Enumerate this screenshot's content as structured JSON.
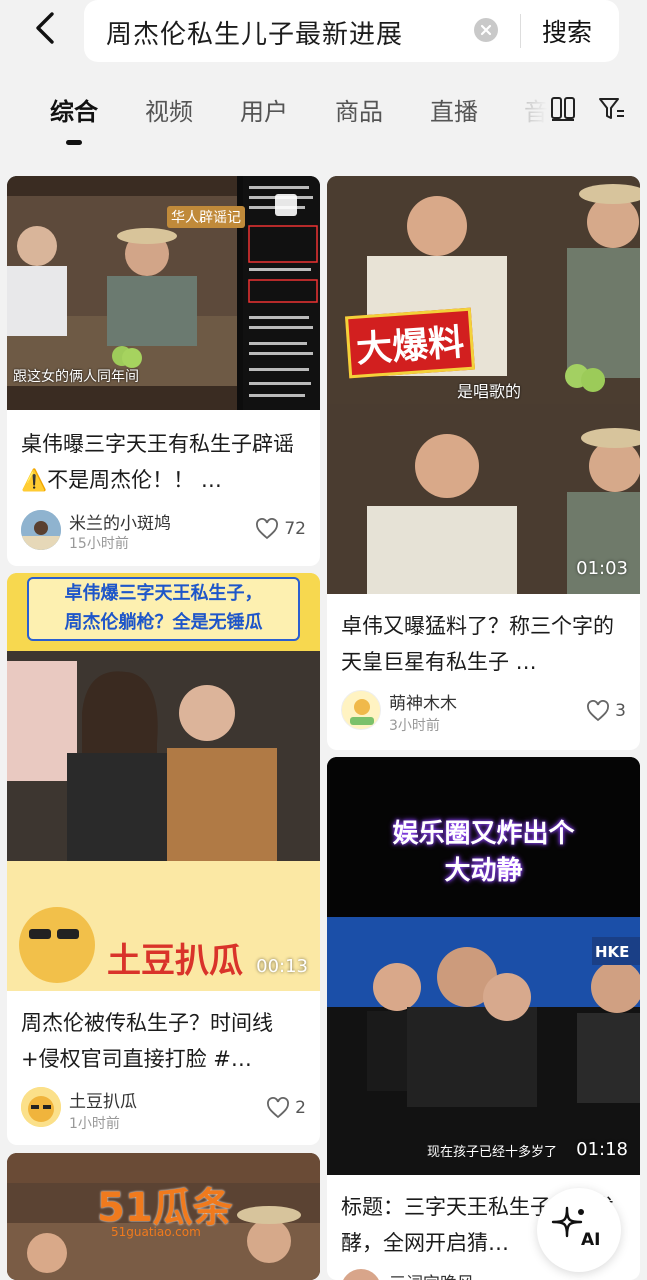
{
  "search": {
    "query": "周杰伦私生儿子最新进展",
    "button_label": "搜索"
  },
  "tabs": [
    {
      "label": "综合",
      "active": true
    },
    {
      "label": "视频",
      "active": false
    },
    {
      "label": "用户",
      "active": false
    },
    {
      "label": "商品",
      "active": false
    },
    {
      "label": "直播",
      "active": false
    },
    {
      "label": "音",
      "active": false
    }
  ],
  "cards": [
    {
      "title": "桌伟曝三字天王有私生子辟谣⚠️不是周杰伦！！ …",
      "author": "米兰的小斑鸠",
      "time": "15小时前",
      "likes": "72",
      "thumb_text": {
        "caption": "跟这女的俩人同年间",
        "badge": "华人辟谣记"
      }
    },
    {
      "title": "卓伟又曝猛料了？称三个字的天皇巨星有私生子 …",
      "author": "萌神木木",
      "time": "3小时前",
      "likes": "3",
      "duration": "01:03",
      "thumb_text": {
        "headline": "大爆料",
        "caption": "是唱歌的"
      }
    },
    {
      "title": "周杰伦被传私生子？时间线+侵权官司直接打脸 #…",
      "author": "土豆扒瓜",
      "time": "1小时前",
      "likes": "2",
      "duration": "00:13",
      "thumb_text": {
        "banner_line1": "卓伟爆三字天王私生子，",
        "banner_line2": "周杰伦躺枪？全是无锤瓜",
        "brand": "土豆扒瓜"
      }
    },
    {
      "title": "标题：三字天王私生子传闻发酵，全网开启猜…",
      "author": "三词完晚风",
      "time": "",
      "likes": "",
      "duration": "01:18",
      "thumb_text": {
        "top_line1": "娱乐圈又炸出个",
        "top_line2": "大动静",
        "caption": "现在孩子已经十多岁了",
        "logo": "HKE"
      }
    },
    {
      "title": "",
      "thumb_text": {
        "logo": "51瓜条",
        "logo_sub": "51guatiao.com"
      }
    }
  ],
  "ai_button": {
    "label": "AI"
  },
  "colors": {
    "background": "#f2f2f2",
    "card": "#ffffff",
    "text": "#1b1b1b",
    "muted": "#999999"
  }
}
